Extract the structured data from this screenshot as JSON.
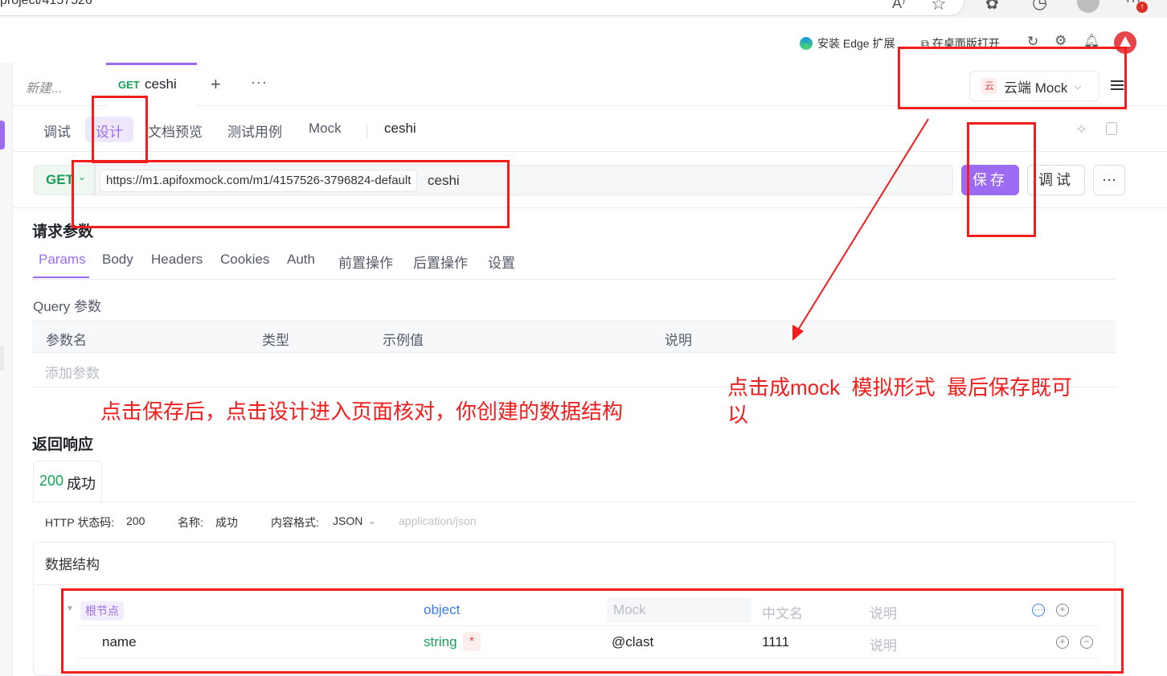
{
  "browser": {
    "url_fragment": "project/4157526",
    "edge_ext_label": "安装 Edge 扩展",
    "desktop_open_label": "在桌面版打开"
  },
  "tabs": {
    "new_tab": "新建...",
    "active_method": "GET",
    "active_name": "ceshi",
    "add": "+",
    "more": "···"
  },
  "env": {
    "icon_text": "云",
    "label": "云端 Mock",
    "chevron": "⌄"
  },
  "subtabs": [
    "调试",
    "设计",
    "文档预览",
    "测试用例",
    "Mock",
    "ceshi"
  ],
  "request": {
    "method": "GET",
    "base_url": "https://m1.apifoxmock.com/m1/4157526-3796824-default",
    "path": "ceshi",
    "save_label": "保存",
    "debug_label": "调试",
    "more_label": "···"
  },
  "params": {
    "title": "请求参数",
    "tabs": [
      "Params",
      "Body",
      "Headers",
      "Cookies",
      "Auth",
      "前置操作",
      "后置操作",
      "设置"
    ],
    "query_label": "Query 参数",
    "columns": [
      "参数名",
      "类型",
      "示例值",
      "说明"
    ],
    "add_placeholder": "添加参数"
  },
  "response": {
    "title": "返回响应",
    "tab_code": "200",
    "tab_text": "成功",
    "meta": {
      "status_label": "HTTP 状态码:",
      "status_value": "200",
      "name_label": "名称:",
      "name_value": "成功",
      "format_label": "内容格式:",
      "format_value": "JSON",
      "content_type": "application/json"
    },
    "schema_title": "数据结构",
    "rows": [
      {
        "name": "根节点",
        "type": "object",
        "mock": "Mock",
        "cn": "中文名",
        "desc": "说明"
      },
      {
        "name": "name",
        "type": "string",
        "required": "*",
        "mock": "@clast",
        "cn": "1111",
        "desc": "说明"
      }
    ]
  },
  "annotations": {
    "left_note": "点击保存后，点击设计进入页面核对，你创建的数据结构",
    "right_note_line1": "点击成mock  模拟形式  最后保存既可",
    "right_note_line2": "以"
  },
  "colors": {
    "accent": "#9b6cf2",
    "get_green": "#18a058",
    "annotation_red": "#f21e1e"
  }
}
